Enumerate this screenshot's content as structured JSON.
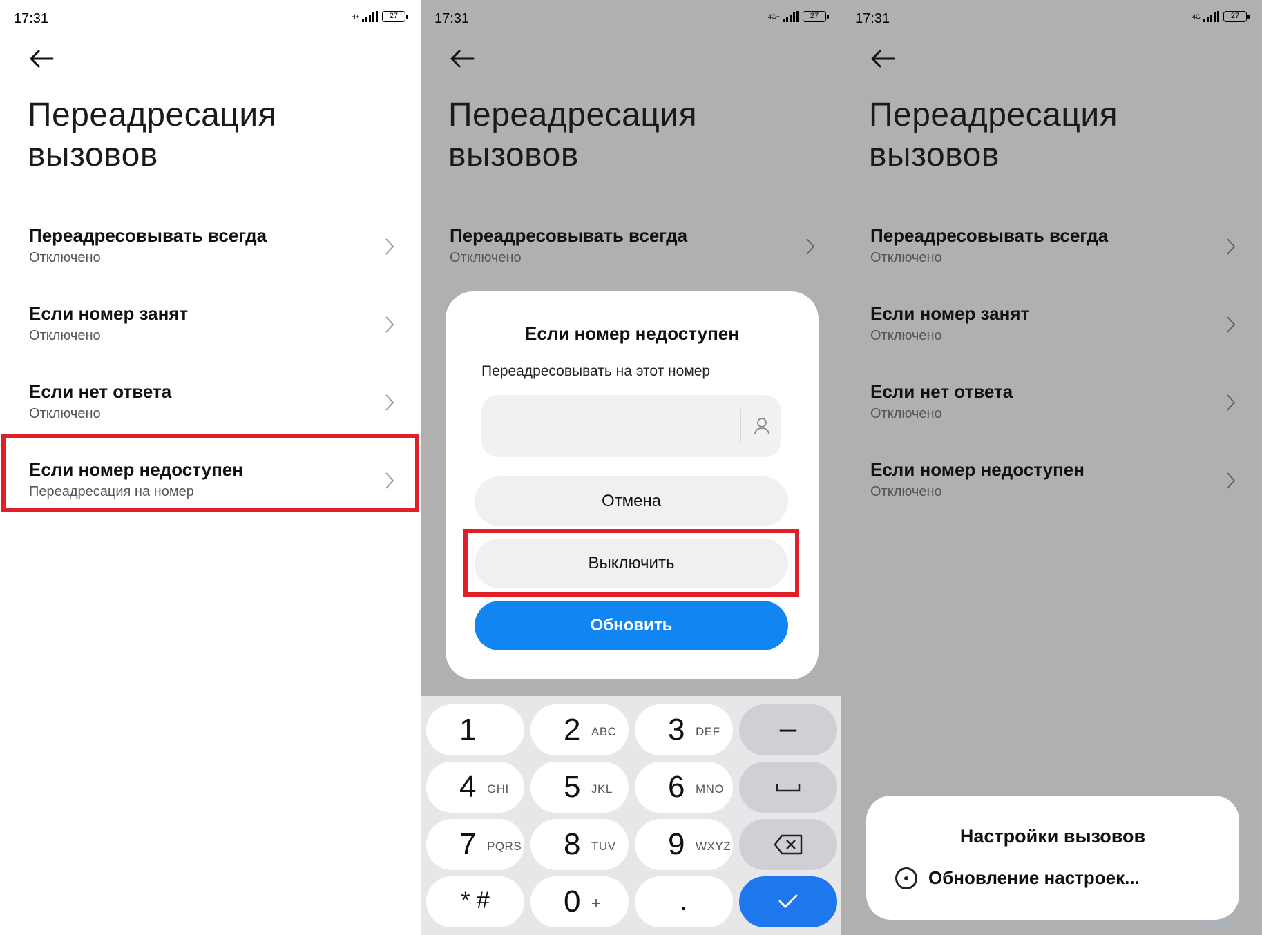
{
  "status": {
    "time": "17:31",
    "battery": "27",
    "net": [
      "H+",
      "4G+",
      "4G"
    ]
  },
  "title": [
    "Переадресация",
    "вызовов"
  ],
  "settings": [
    {
      "label": "Переадресовывать всегда",
      "value": "Отключено"
    },
    {
      "label": "Если номер занят",
      "value": "Отключено"
    },
    {
      "label": "Если нет ответа",
      "value": "Отключено"
    },
    {
      "label": "Если номер недоступен",
      "value": "Переадресация на номер"
    }
  ],
  "settings_after": [
    {
      "label": "Переадресовывать всегда",
      "value": "Отключено"
    },
    {
      "label": "Если номер занят",
      "value": "Отключено"
    },
    {
      "label": "Если нет ответа",
      "value": "Отключено"
    },
    {
      "label": "Если номер недоступен",
      "value": "Отключено"
    }
  ],
  "dialog": {
    "title": "Если номер недоступен",
    "label": "Переадресовывать на этот номер",
    "input_value": "",
    "cancel": "Отмена",
    "disable": "Выключить",
    "update": "Обновить"
  },
  "keypad": [
    {
      "digit": "1",
      "letters": ""
    },
    {
      "digit": "2",
      "letters": "ABC"
    },
    {
      "digit": "3",
      "letters": "DEF"
    },
    {
      "digit": "4",
      "letters": "GHI"
    },
    {
      "digit": "5",
      "letters": "JKL"
    },
    {
      "digit": "6",
      "letters": "MNO"
    },
    {
      "digit": "7",
      "letters": "PQRS"
    },
    {
      "digit": "8",
      "letters": "TUV"
    },
    {
      "digit": "9",
      "letters": "WXYZ"
    }
  ],
  "keypad_bottom": {
    "symbols": "* #",
    "zero": "0",
    "plus": "+",
    "dot": ".",
    "minus": "–"
  },
  "toast": {
    "title": "Настройки вызовов",
    "message": "Обновление настроек..."
  },
  "watermark": "24hitech.ru",
  "colors": {
    "highlight": "#e01f26",
    "primary": "#1185f2",
    "overlay": "#b0b0b0"
  }
}
